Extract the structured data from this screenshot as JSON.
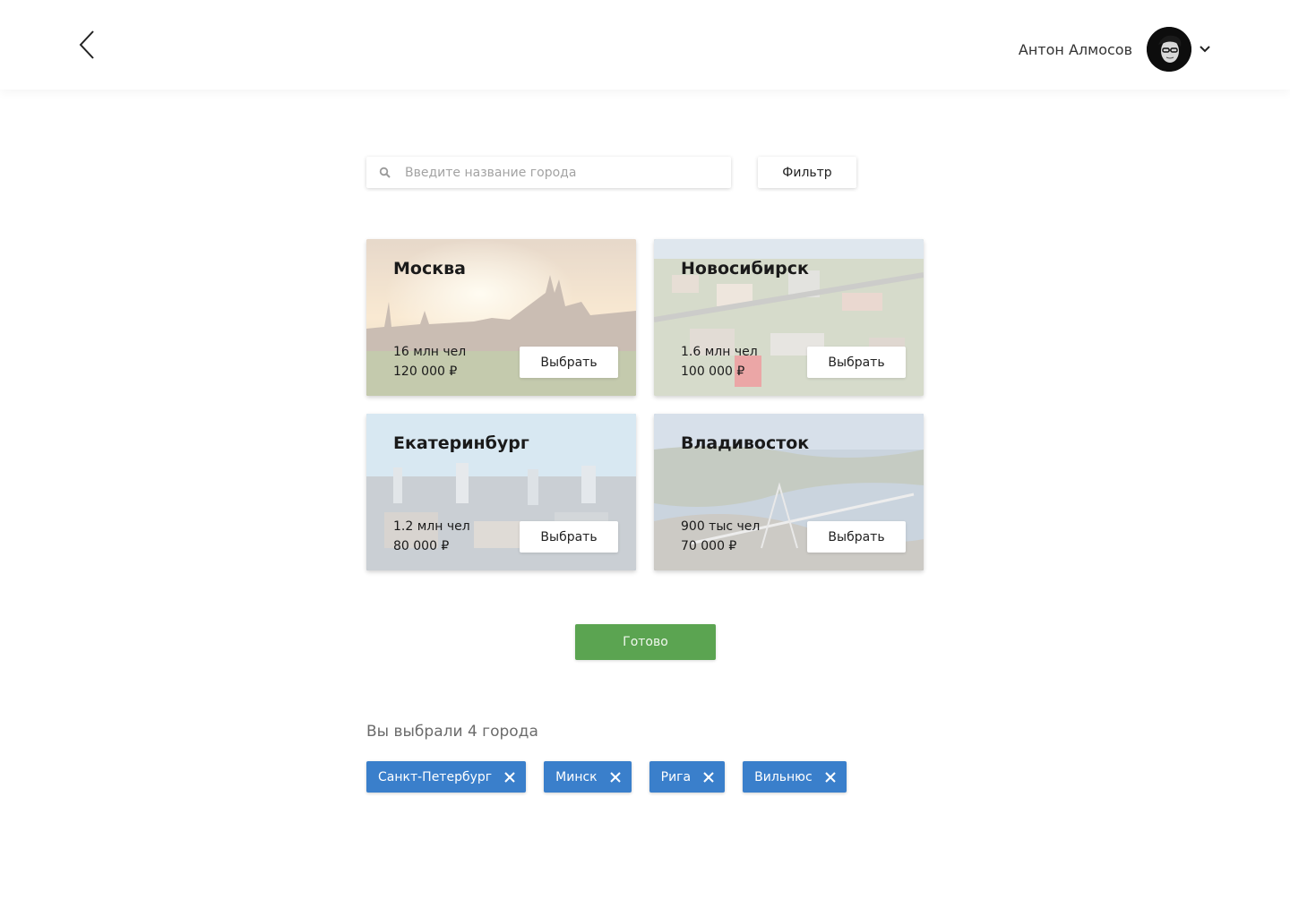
{
  "header": {
    "user_name": "Антон Алмосов"
  },
  "search": {
    "placeholder": "Введите название города",
    "value": ""
  },
  "filter": {
    "label": "Фильтр"
  },
  "cities": [
    {
      "name": "Москва",
      "population": "16 млн чел",
      "price": "120 000 ₽",
      "select_label": "Выбрать"
    },
    {
      "name": "Новосибирск",
      "population": "1.6 млн чел",
      "price": "100 000 ₽",
      "select_label": "Выбрать"
    },
    {
      "name": "Екатеринбург",
      "population": "1.2 млн чел",
      "price": "80 000 ₽",
      "select_label": "Выбрать"
    },
    {
      "name": "Владивосток",
      "population": "900 тыс чел",
      "price": "70 000 ₽",
      "select_label": "Выбрать"
    }
  ],
  "done": {
    "label": "Готово"
  },
  "selected": {
    "label": "Вы выбрали 4 города",
    "chips": [
      "Санкт-Петербург",
      "Минск",
      "Рига",
      "Вильнюс"
    ]
  },
  "colors": {
    "primary_green": "#5ba451",
    "chip_blue": "#3a7fcb"
  }
}
